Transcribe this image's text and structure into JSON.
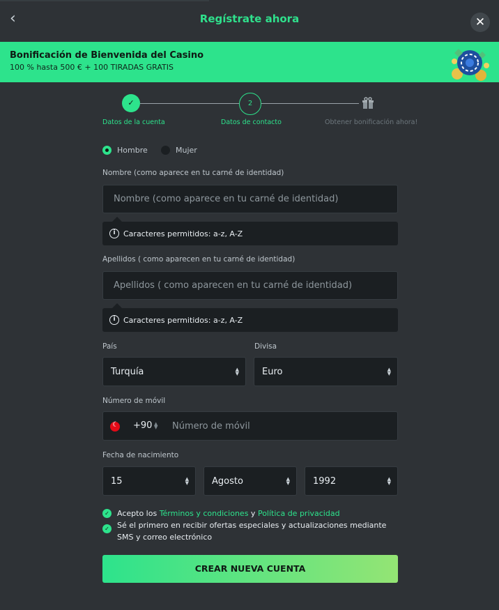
{
  "header": {
    "title": "Regístrate ahora"
  },
  "banner": {
    "title": "Bonificación de Bienvenida del Casino",
    "subtitle": "100 % hasta 500 € + 100 TIRADAS GRATIS"
  },
  "stepper": {
    "steps": [
      {
        "label": "Datos de la cuenta",
        "state": "done"
      },
      {
        "label": "Datos de contacto",
        "number": "2",
        "state": "active"
      },
      {
        "label": "Obtener bonificación ahora!",
        "state": "pending"
      }
    ]
  },
  "gender": {
    "options": [
      "Hombre",
      "Mujer"
    ],
    "selected": "Hombre"
  },
  "first_name": {
    "label": "Nombre (como aparece en tu carné de identidad)",
    "placeholder": "Nombre (como aparece en tu carné de identidad)",
    "hint": "Caracteres permitidos: a-z, A-Z"
  },
  "last_name": {
    "label": "Apellidos ( como aparecen en tu carné de identidad)",
    "placeholder": "Apellidos ( como aparecen en tu carné de identidad)",
    "hint": "Caracteres permitidos: a-z, A-Z"
  },
  "country": {
    "label": "País",
    "value": "Turquía"
  },
  "currency": {
    "label": "Divisa",
    "value": "Euro"
  },
  "mobile": {
    "label": "Número de móvil",
    "prefix": "+90",
    "placeholder": "Número de móvil"
  },
  "birth": {
    "label": "Fecha de nacimiento",
    "day": "15",
    "month": "Agosto",
    "year": "1992"
  },
  "terms": {
    "prefix": "Acepto los ",
    "terms_link": "Términos y condiciones",
    "and": " y ",
    "privacy_link": "Política de privacidad"
  },
  "offers": {
    "text": "Sé el primero en recibir ofertas especiales y actualizaciones mediante SMS y correo electrónico"
  },
  "cta": {
    "label": "CREAR NUEVA CUENTA"
  },
  "colors": {
    "accent": "#2de38c",
    "background": "#2e3236",
    "field": "#1b1f22"
  }
}
